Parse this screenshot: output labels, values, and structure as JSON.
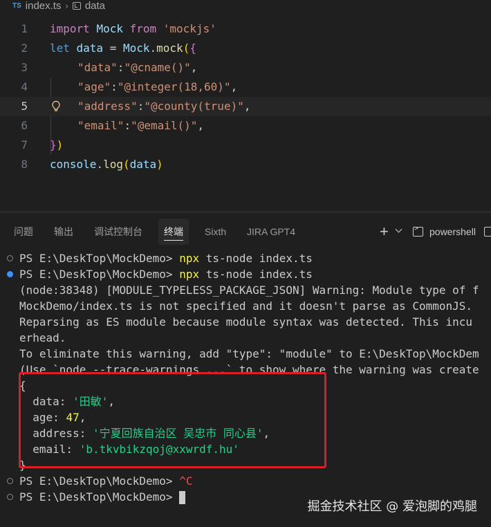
{
  "breadcrumb": {
    "lang_badge": "TS",
    "file": "index.ts",
    "symbol": "data"
  },
  "editor": {
    "lines": [
      {
        "num": "1",
        "tokens": [
          [
            "kw",
            "import "
          ],
          [
            "var",
            "Mock "
          ],
          [
            "kw",
            "from "
          ],
          [
            "str",
            "'mockjs'"
          ]
        ]
      },
      {
        "num": "2",
        "tokens": [
          [
            "kw2",
            "let "
          ],
          [
            "var",
            "data "
          ],
          [
            "punc",
            "= "
          ],
          [
            "var",
            "Mock"
          ],
          [
            "punc",
            "."
          ],
          [
            "fn",
            "mock"
          ],
          [
            "brace2",
            "("
          ],
          [
            "brace",
            "{"
          ]
        ]
      },
      {
        "num": "3",
        "tokens": [
          [
            "str",
            "\"data\""
          ],
          [
            "punc",
            ":"
          ],
          [
            "str",
            "\"@cname()\""
          ],
          [
            "punc",
            ","
          ]
        ]
      },
      {
        "num": "4",
        "tokens": [
          [
            "str",
            "\"age\""
          ],
          [
            "punc",
            ":"
          ],
          [
            "str",
            "\"@integer(18,60)\""
          ],
          [
            "punc",
            ","
          ]
        ]
      },
      {
        "num": "5",
        "tokens": [
          [
            "str",
            "\"address\""
          ],
          [
            "punc",
            ":"
          ],
          [
            "str",
            "\"@county(true)\""
          ],
          [
            "punc",
            ","
          ]
        ]
      },
      {
        "num": "6",
        "tokens": [
          [
            "str",
            "\"email\""
          ],
          [
            "punc",
            ":"
          ],
          [
            "str",
            "\"@email()\""
          ],
          [
            "punc",
            ","
          ]
        ]
      },
      {
        "num": "7",
        "tokens": [
          [
            "brace",
            "}"
          ],
          [
            "brace2",
            ")"
          ]
        ]
      },
      {
        "num": "8",
        "tokens": [
          [
            "var",
            "console"
          ],
          [
            "punc",
            "."
          ],
          [
            "fn",
            "log"
          ],
          [
            "brace2",
            "("
          ],
          [
            "var",
            "data"
          ],
          [
            "brace2",
            ")"
          ]
        ]
      }
    ],
    "active_line": "5"
  },
  "panel": {
    "tabs": [
      "问题",
      "输出",
      "调试控制台",
      "终端",
      "Sixth",
      "JIRA GPT4"
    ],
    "active_tab": "终端",
    "add_label": "+",
    "terminal_name": "powershell"
  },
  "terminal": {
    "lines": [
      {
        "prompt": "PS E:\\DeskTop\\MockDemo> ",
        "cmd": "npx",
        "rest": " ts-node index.ts"
      },
      {
        "prompt": "PS E:\\DeskTop\\MockDemo> ",
        "cmd": "npx",
        "rest": " ts-node index.ts"
      },
      {
        "text": "(node:38348) [MODULE_TYPELESS_PACKAGE_JSON] Warning: Module type of f"
      },
      {
        "text": "MockDemo/index.ts is not specified and it doesn't parse as CommonJS."
      },
      {
        "text": "Reparsing as ES module because module syntax was detected. This incu"
      },
      {
        "text": "erhead."
      },
      {
        "text": "To eliminate this warning, add \"type\": \"module\" to E:\\DeskTop\\MockDem"
      },
      {
        "text": "(Use `node --trace-warnings ...` to show where the warning was create"
      },
      {
        "text": "{"
      },
      {
        "key": "  data: ",
        "val": "'田敏'",
        "tail": ","
      },
      {
        "key": "  age: ",
        "num": "47",
        "tail": ","
      },
      {
        "key": "  address: ",
        "val": "'宁夏回族自治区 吴忠市 同心县'",
        "tail": ","
      },
      {
        "key": "  email: ",
        "val": "'b.tkvbikzqoj@xxwrdf.hu'"
      },
      {
        "text": "}"
      },
      {
        "prompt": "PS E:\\DeskTop\\MockDemo> ",
        "interrupt": "^C"
      },
      {
        "prompt": "PS E:\\DeskTop\\MockDemo> "
      }
    ]
  },
  "watermark": "掘金技术社区 @ 爱泡脚的鸡腿"
}
